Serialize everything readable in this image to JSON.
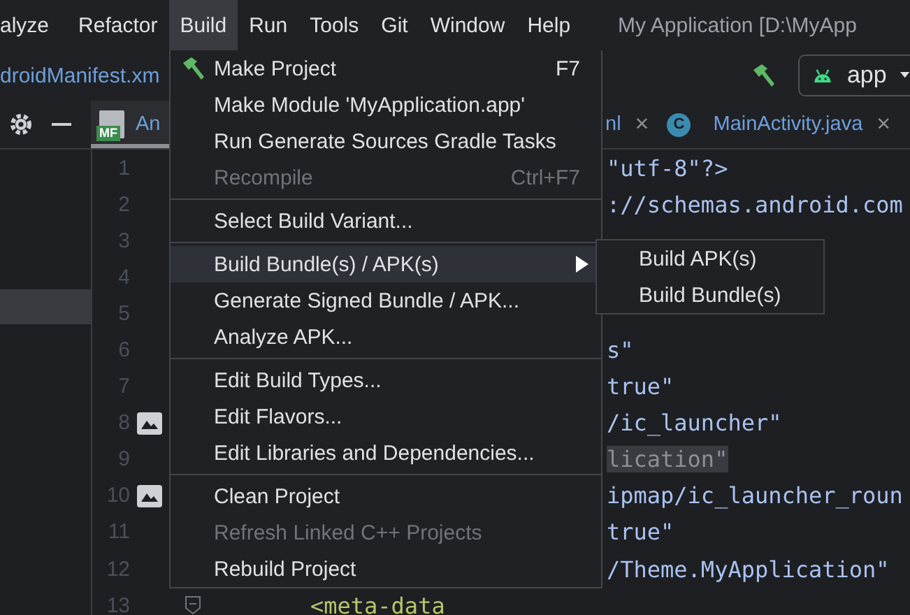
{
  "menubar": {
    "menus": [
      {
        "label": "alyze",
        "selected": false
      },
      {
        "label": "Refactor",
        "selected": false
      },
      {
        "label": "Build",
        "selected": true
      },
      {
        "label": "Run",
        "selected": false
      },
      {
        "label": "Tools",
        "selected": false
      },
      {
        "label": "Git",
        "selected": false
      },
      {
        "label": "Window",
        "selected": false
      },
      {
        "label": "Help",
        "selected": false
      }
    ],
    "title": "My Application [D:\\MyApp"
  },
  "toolbar": {
    "breadcrumb": "droidManifest.xm",
    "run_config": "app"
  },
  "tool_window": {
    "rows": [
      {
        "selected": false
      },
      {
        "selected": false
      },
      {
        "selected": false
      },
      {
        "selected": false
      },
      {
        "selected": true
      }
    ]
  },
  "tabs": [
    {
      "label": "An",
      "badge": "MF",
      "kind": "manifest",
      "selected": true
    },
    {
      "label": "nl",
      "close": "×",
      "selected": false
    },
    {
      "label": "MainActivity.java",
      "badge": "C",
      "kind": "class",
      "close": "×",
      "selected": false
    }
  ],
  "editor": {
    "lines": [
      {
        "number": "1",
        "text": "\"utf-8\"?>",
        "kind": "tail",
        "image_marker": false,
        "highlighted": false
      },
      {
        "number": "2",
        "text": "://schemas.android.com",
        "kind": "tail",
        "image_marker": false,
        "highlighted": false
      },
      {
        "number": "3",
        "kind": "tail",
        "image_marker": false
      },
      {
        "number": "4",
        "kind": "tail",
        "image_marker": false
      },
      {
        "number": "5",
        "kind": "tail",
        "image_marker": false
      },
      {
        "number": "6",
        "text": "s\"",
        "kind": "tail",
        "image_marker": false,
        "highlighted": false
      },
      {
        "number": "7",
        "text": "true\"",
        "kind": "tail",
        "image_marker": false,
        "highlighted": false
      },
      {
        "number": "8",
        "text": "/ic_launcher\"",
        "kind": "tail",
        "image_marker": true,
        "highlighted": false
      },
      {
        "number": "9",
        "text": "lication\"",
        "kind": "tail",
        "image_marker": false,
        "highlighted": true
      },
      {
        "number": "10",
        "text": "ipmap/ic_launcher_roun",
        "kind": "tail",
        "image_marker": true,
        "highlighted": false
      },
      {
        "number": "11",
        "text": "true\"",
        "kind": "tail",
        "image_marker": false,
        "highlighted": false
      },
      {
        "number": "12",
        "text": "/Theme.MyApplication\"",
        "kind": "tail",
        "image_marker": false,
        "highlighted": false
      },
      {
        "number": "13",
        "text": "<meta-data",
        "kind": "tag",
        "image_marker": false,
        "fold_marker": true,
        "highlighted": false
      }
    ]
  },
  "build_menu": {
    "groups": [
      [
        {
          "label": "Make Project",
          "shortcut": "F7",
          "icon": true,
          "disabled": false,
          "selected": false,
          "submenu": false
        },
        {
          "label": "Make Module 'MyApplication.app'",
          "icon": false,
          "disabled": false,
          "selected": false,
          "submenu": false
        },
        {
          "label": "Run Generate Sources Gradle Tasks",
          "icon": false,
          "disabled": false,
          "selected": false,
          "submenu": false
        },
        {
          "label": "Recompile",
          "shortcut": "Ctrl+F7",
          "icon": false,
          "disabled": true,
          "selected": false,
          "submenu": false
        }
      ],
      [
        {
          "label": "Select Build Variant...",
          "icon": false,
          "disabled": false,
          "selected": false,
          "submenu": false
        }
      ],
      [
        {
          "label": "Build Bundle(s) / APK(s)",
          "icon": false,
          "disabled": false,
          "selected": true,
          "submenu": true
        },
        {
          "label": "Generate Signed Bundle / APK...",
          "icon": false,
          "disabled": false,
          "selected": false,
          "submenu": false
        },
        {
          "label": "Analyze APK...",
          "icon": false,
          "disabled": false,
          "selected": false,
          "submenu": false
        }
      ],
      [
        {
          "label": "Edit Build Types...",
          "icon": false,
          "disabled": false,
          "selected": false,
          "submenu": false
        },
        {
          "label": "Edit Flavors...",
          "icon": false,
          "disabled": false,
          "selected": false,
          "submenu": false
        },
        {
          "label": "Edit Libraries and Dependencies...",
          "icon": false,
          "disabled": false,
          "selected": false,
          "submenu": false
        }
      ],
      [
        {
          "label": "Clean Project",
          "icon": false,
          "disabled": false,
          "selected": false,
          "submenu": false
        },
        {
          "label": "Refresh Linked C++ Projects",
          "icon": false,
          "disabled": true,
          "selected": false,
          "submenu": false
        },
        {
          "label": "Rebuild Project",
          "icon": false,
          "disabled": false,
          "selected": false,
          "submenu": false
        }
      ]
    ]
  },
  "submenu": {
    "items": [
      {
        "label": "Build APK(s)",
        "selected": false
      },
      {
        "label": "Build Bundle(s)",
        "selected": false
      }
    ]
  }
}
